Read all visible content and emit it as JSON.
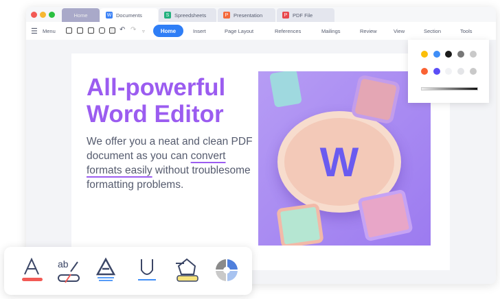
{
  "tabs": [
    {
      "label": "Home"
    },
    {
      "label": "Documents",
      "icon": "W",
      "color": "#3b82f6"
    },
    {
      "label": "Spreedsheets",
      "icon": "S",
      "color": "#22b07d"
    },
    {
      "label": "Presentation",
      "icon": "P",
      "color": "#f4683a"
    },
    {
      "label": "PDF File",
      "icon": "P",
      "color": "#e8474c"
    }
  ],
  "toolbar": {
    "menu": "Menu",
    "home": "Home",
    "items": [
      "Insert",
      "Page Layout",
      "References",
      "Mailings",
      "Review",
      "View",
      "Section",
      "Tools"
    ]
  },
  "doc": {
    "title_line1": "All-powerful",
    "title_line2": "Word Editor",
    "para_a": "We offer you a neat and clean PDF document as you can ",
    "para_link": "convert formats easily",
    "para_b": " without troublesome formatting problems."
  },
  "colors": {
    "row1": [
      "#fbbf0a",
      "#3f8ef7",
      "#1b1b1b",
      "#777777",
      "#c9c9c9"
    ],
    "row2": [
      "#fa6233",
      "#5b4ef6",
      "#f1f2f5",
      "#e4e5e8",
      "#c9c9c9"
    ]
  },
  "art": {
    "logo": "W"
  }
}
